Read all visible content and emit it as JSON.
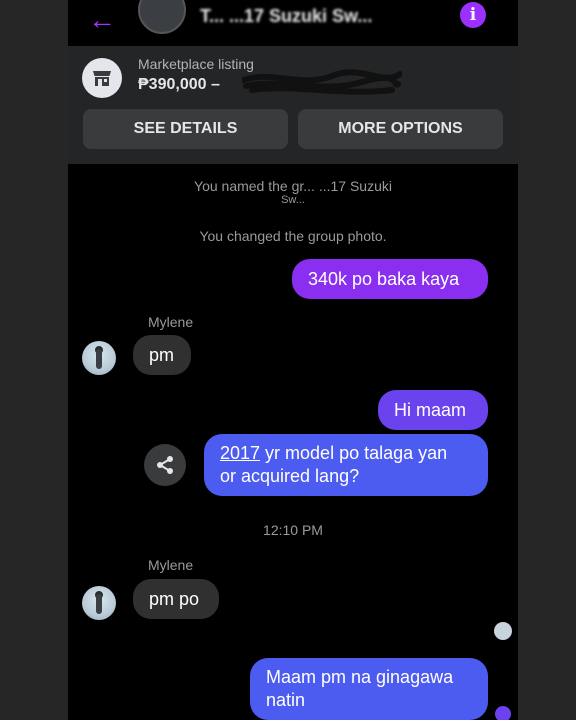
{
  "header": {
    "back_icon": "back-arrow-icon",
    "title": "T... ...17 Suzuki Sw...",
    "info_icon": "info-icon",
    "info_glyph": "i"
  },
  "listing": {
    "label": "Marketplace listing",
    "price": "₱390,000 –",
    "see_details_label": "SEE DETAILS",
    "more_options_label": "MORE OPTIONS"
  },
  "system": {
    "renamed_line1": "You named the gr...             ...17 Suzuki",
    "renamed_line2": "Sw...",
    "changed_photo": "You changed the group photo."
  },
  "messages": {
    "m1": "340k po baka kaya",
    "sender1": "Mylene",
    "m2": "pm",
    "m3": "Hi maam",
    "m4_link": "2017",
    "m4_rest": " yr model po talaga yan",
    "m4_line2": "or acquired lang?",
    "time": "12:10 PM",
    "sender2": "Mylene",
    "m5": "pm po",
    "m6_line1": "Maam pm na ginagawa",
    "m6_line2": "natin"
  },
  "colors": {
    "accent": "#a033ff",
    "outgoing_purple": "#8a2ff0",
    "outgoing_violet": "#6b43ee",
    "outgoing_blue": "#4d5cf0",
    "incoming": "#303030"
  }
}
